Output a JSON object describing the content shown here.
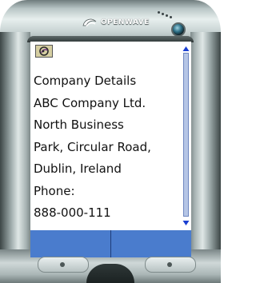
{
  "device": {
    "brand": "OPENWAVE"
  },
  "screen": {
    "lines": [
      "Company Details",
      "ABC Company Ltd.",
      "North Business",
      "Park, Circular Road,",
      "Dublin, Ireland",
      "Phone:",
      "888-000-111"
    ]
  },
  "colors": {
    "softkey_bar": "#4a7ccd",
    "scrollbar": "#b6c6e6",
    "scroll_arrow": "#1a3fd1",
    "icon_box": "#d6cfa2"
  },
  "icons": {
    "menu": "openwave-menu-icon",
    "scroll_up": "scroll-up-arrow-icon",
    "scroll_down": "scroll-down-arrow-icon"
  }
}
